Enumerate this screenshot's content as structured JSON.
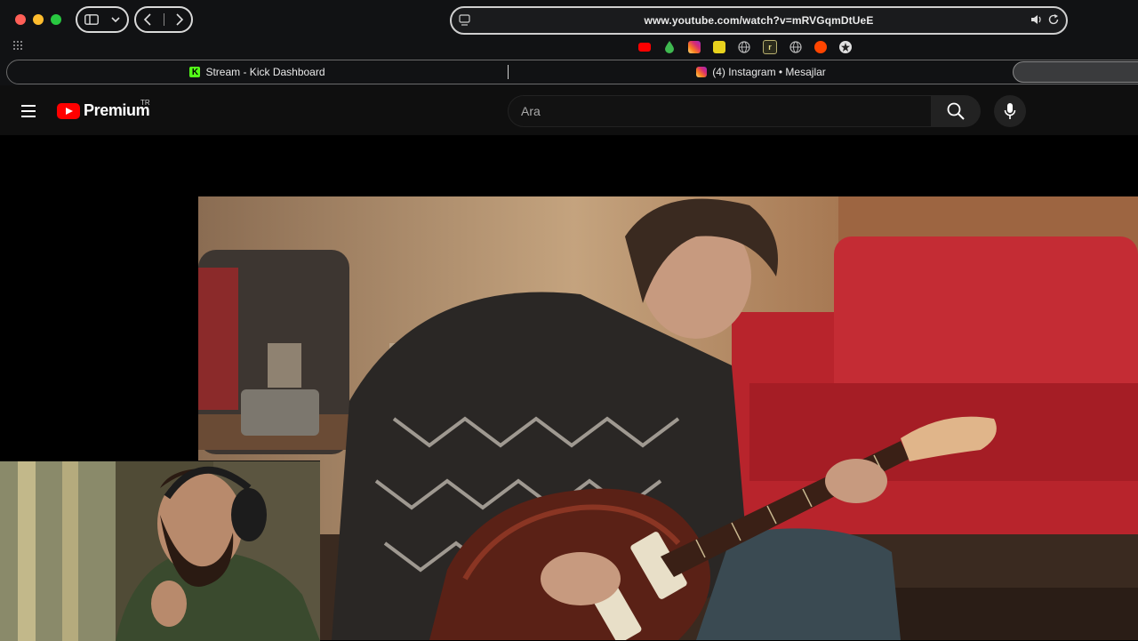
{
  "browser": {
    "url": "www.youtube.com/watch?v=mRVGqmDtUeE",
    "tabs": [
      {
        "label": "Stream - Kick Dashboard"
      },
      {
        "label": "(4) Instagram • Mesajlar"
      }
    ],
    "favorites": [
      "youtube-icon",
      "drop-icon",
      "instagram-icon",
      "yellow-app-icon",
      "globe-icon",
      "r-icon",
      "globe-icon",
      "reddit-icon",
      "star-icon"
    ],
    "favorite_letter": "r"
  },
  "youtube": {
    "logo_text": "Premium",
    "region": "TR",
    "search_placeholder": "Ara"
  },
  "colors": {
    "accent_red": "#ff0000",
    "kick_green": "#53fc18",
    "chrome_bg": "#111214",
    "yt_bg": "#0f0f0f"
  }
}
